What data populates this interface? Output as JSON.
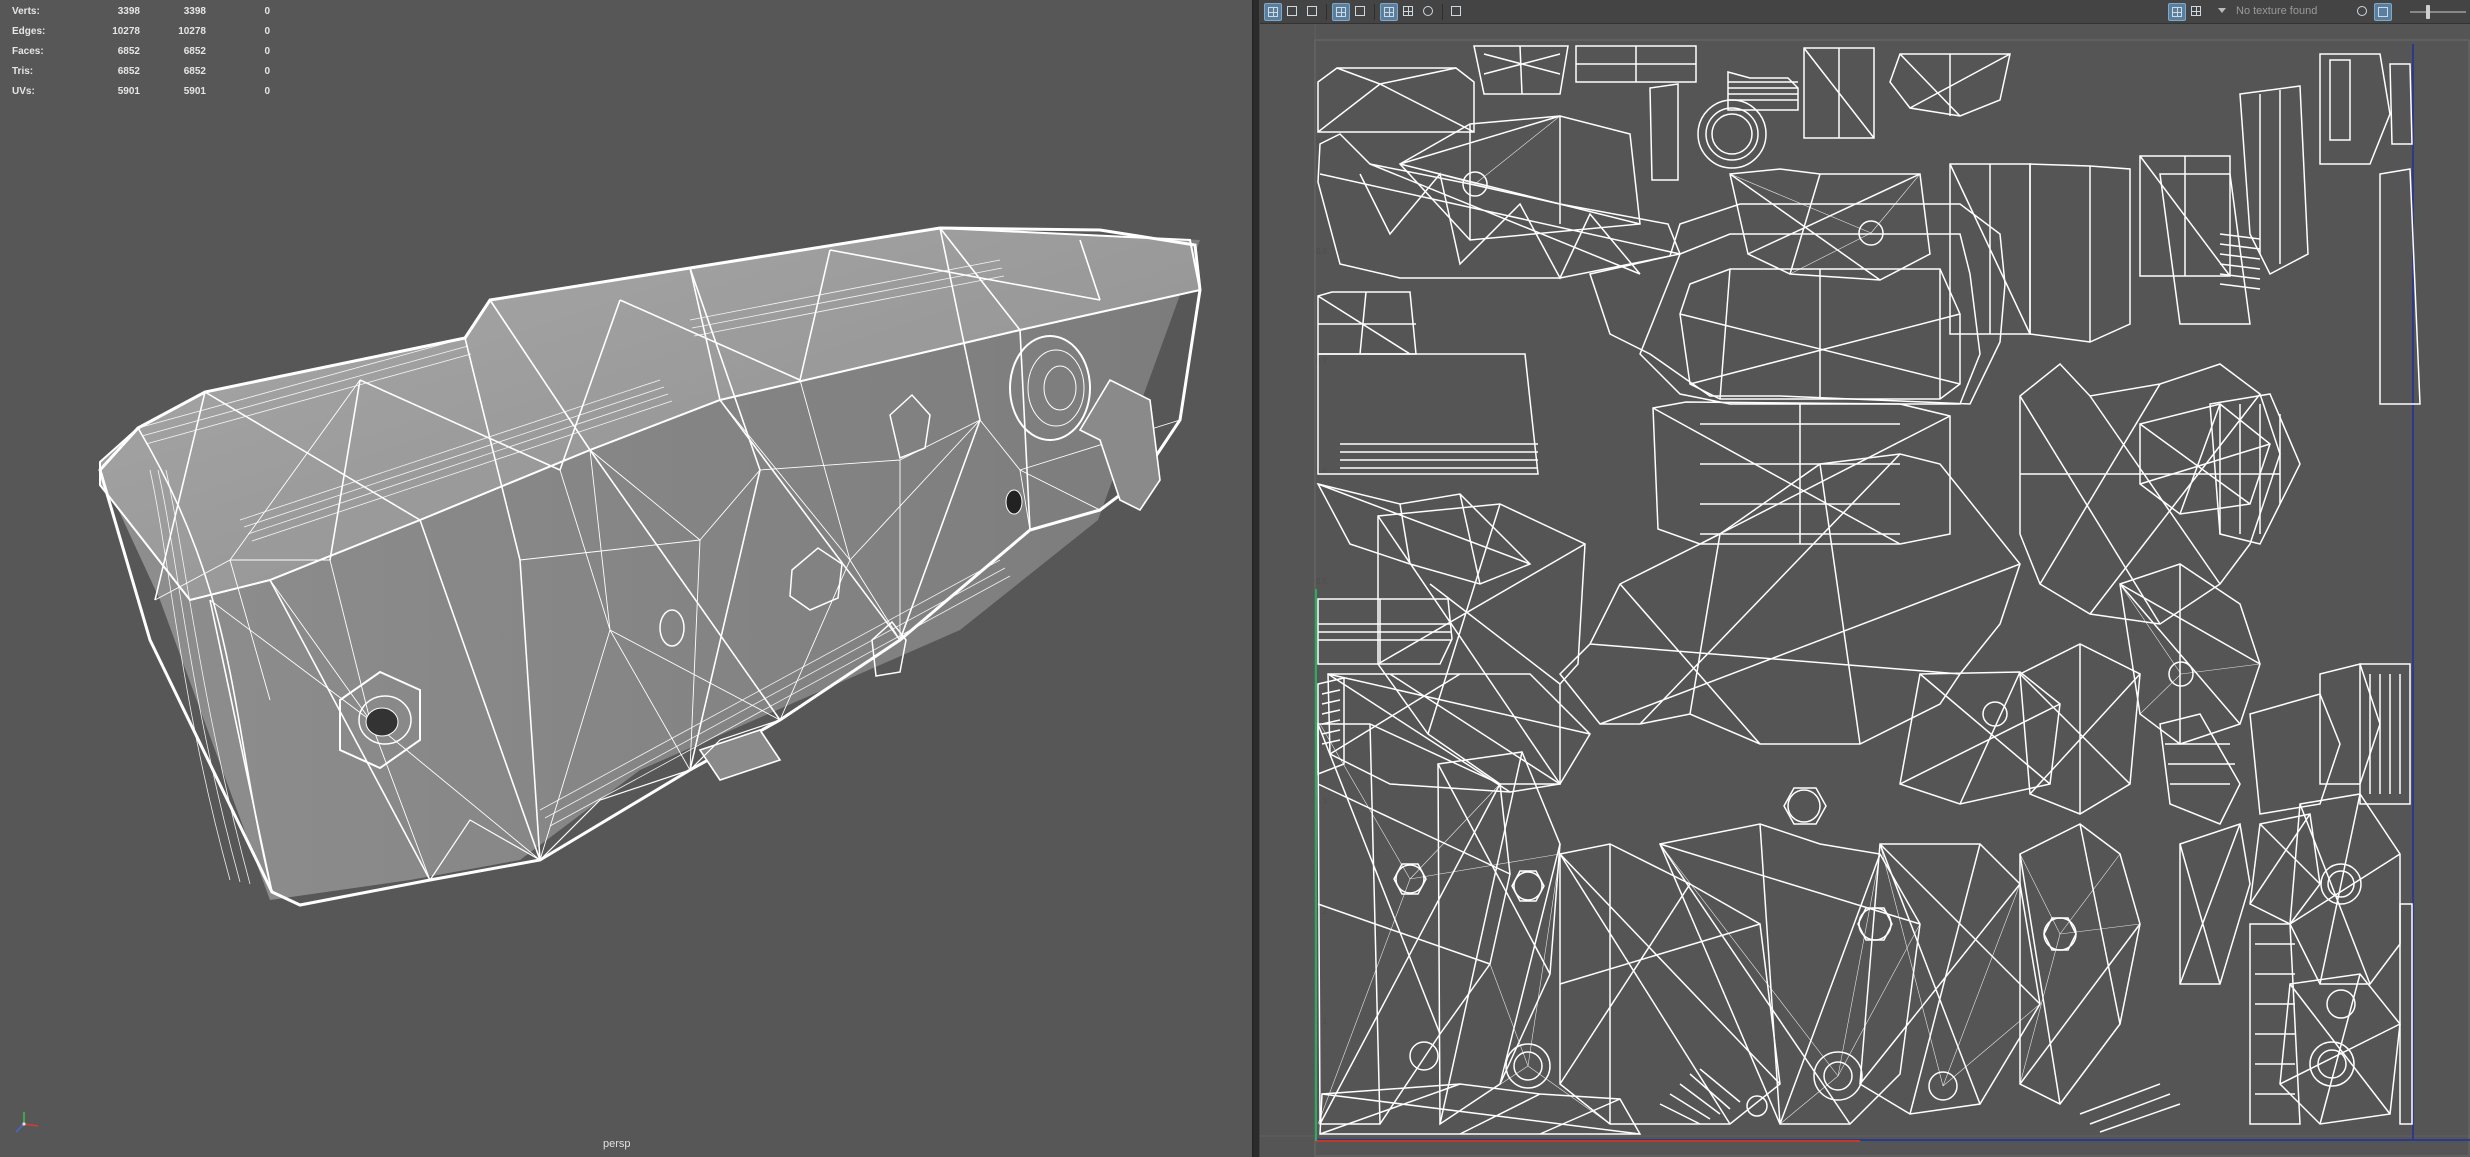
{
  "hud": {
    "rows": [
      {
        "label": "Verts:",
        "c1": "3398",
        "c2": "3398",
        "c3": "0"
      },
      {
        "label": "Edges:",
        "c1": "10278",
        "c2": "10278",
        "c3": "0"
      },
      {
        "label": "Faces:",
        "c1": "6852",
        "c2": "6852",
        "c3": "0"
      },
      {
        "label": "Tris:",
        "c1": "6852",
        "c2": "6852",
        "c3": "0"
      },
      {
        "label": "UVs:",
        "c1": "5901",
        "c2": "5901",
        "c3": "0"
      }
    ]
  },
  "viewport": {
    "camera": "persp",
    "background": "#575757"
  },
  "uv_editor": {
    "status": "No texture found",
    "background": "#555555",
    "toolbar_icons": [
      "uv-shell-icon",
      "uv-select-icon",
      "uv-image-icon",
      "wireframe-icon",
      "grid-display-icon",
      "shaded-icon",
      "checker-icon",
      "isolate-icon",
      "camera-icon"
    ],
    "right_icons": [
      "texture-toggle-icon",
      "checker-pattern-icon",
      "dropdown-icon",
      "display-icon",
      "lock-icon"
    ]
  },
  "colors": {
    "wire": "#ffffff",
    "axis_u": "#c0392b",
    "axis_v": "#27ae60",
    "frame": "#2d3a8c"
  }
}
